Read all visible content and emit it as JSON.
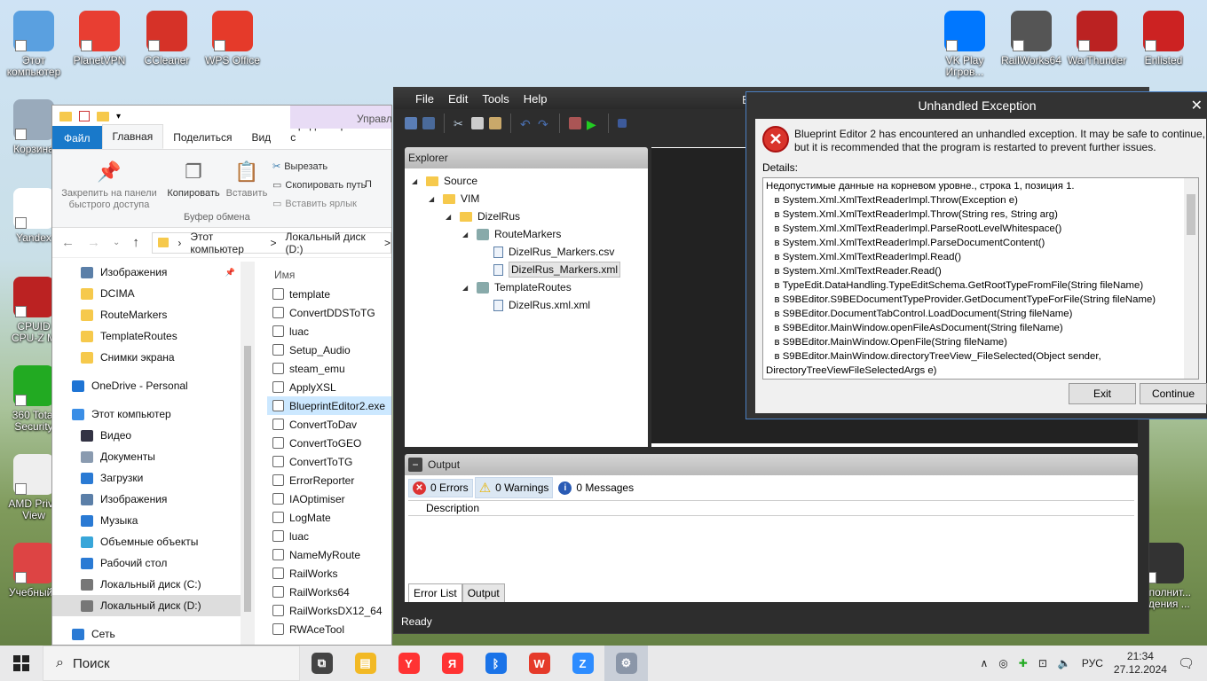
{
  "desktop_icons": [
    {
      "label": "Этот\nкомпьютер",
      "icon": "computer-icon",
      "color": "#5aa0e0"
    },
    {
      "label": "PlanetVPN",
      "icon": "planetvpn-icon",
      "color": "#e83e32"
    },
    {
      "label": "CCleaner",
      "icon": "ccleaner-icon",
      "color": "#d63228"
    },
    {
      "label": "WPS Office",
      "icon": "wps-office-icon",
      "color": "#e53a2a"
    },
    {
      "label": "Корзина",
      "icon": "recycle-bin-icon",
      "color": "#9ab"
    },
    {
      "label": "Yandex",
      "icon": "yandex-icon",
      "color": "#fff"
    },
    {
      "label": "CPUID\nCPU-Z M",
      "icon": "cpuz-icon",
      "color": "#b22"
    },
    {
      "label": "360 Total\nSecurity",
      "icon": "360-security-icon",
      "color": "#2a2"
    },
    {
      "label": "AMD Priva\nView",
      "icon": "amd-icon",
      "color": "#eee"
    },
    {
      "label": "Учебный_",
      "icon": "pdf-icon",
      "color": "#d44"
    },
    {
      "label": "VK Play\nИгров...",
      "icon": "vkplay-icon",
      "color": "#0077ff"
    },
    {
      "label": "RailWorks64",
      "icon": "railworks-icon",
      "color": "#555"
    },
    {
      "label": "WarThunder",
      "icon": "warthunder-icon",
      "color": "#b22"
    },
    {
      "label": "Enlisted",
      "icon": "enlisted-icon",
      "color": "#c22"
    },
    {
      "label": "Исполнит...\nведения ...",
      "icon": "launcher-icon",
      "color": "#333"
    }
  ],
  "explorer": {
    "context_tab": "Управл",
    "tabs": [
      "Файл",
      "Главная",
      "Поделиться",
      "Вид",
      "Средства работы с"
    ],
    "ribbon": {
      "pin": "Закрепить на панели\nбыстрого доступа",
      "copy": "Копировать",
      "paste": "Вставить",
      "cut": "Вырезать",
      "copy_path": "Скопировать путь",
      "paste_shortcut": "Вставить ярлык",
      "group": "Буфер обмена",
      "more": "П"
    },
    "address": [
      "Этот компьютер",
      ">",
      "Локальный диск (D:)",
      ">"
    ],
    "nav": [
      {
        "label": "Изображения",
        "icon": "pictures-icon",
        "indent": true
      },
      {
        "label": "DCIMA",
        "icon": "folder-icon",
        "indent": true
      },
      {
        "label": "RouteMarkers",
        "icon": "folder-icon",
        "indent": true
      },
      {
        "label": "TemplateRoutes",
        "icon": "folder-icon",
        "indent": true
      },
      {
        "label": "Снимки экрана",
        "icon": "folder-icon",
        "indent": true
      },
      {
        "label": "OneDrive - Personal",
        "icon": "onedrive-icon",
        "indent": false
      },
      {
        "label": "Этот компьютер",
        "icon": "computer-icon",
        "indent": false
      },
      {
        "label": "Видео",
        "icon": "video-icon",
        "indent": true
      },
      {
        "label": "Документы",
        "icon": "documents-icon",
        "indent": true
      },
      {
        "label": "Загрузки",
        "icon": "downloads-icon",
        "indent": true
      },
      {
        "label": "Изображения",
        "icon": "pictures-icon",
        "indent": true
      },
      {
        "label": "Музыка",
        "icon": "music-icon",
        "indent": true
      },
      {
        "label": "Объемные объекты",
        "icon": "3d-objects-icon",
        "indent": true
      },
      {
        "label": "Рабочий стол",
        "icon": "desktop-icon",
        "indent": true
      },
      {
        "label": "Локальный диск (C:)",
        "icon": "drive-icon",
        "indent": true
      },
      {
        "label": "Локальный диск (D:)",
        "icon": "drive-icon",
        "indent": true,
        "selected": true
      },
      {
        "label": "Сеть",
        "icon": "network-icon",
        "indent": false
      }
    ],
    "column_name": "Имя",
    "files": [
      "template",
      "ConvertDDSToTG",
      "luac",
      "Setup_Audio",
      "steam_emu",
      "ApplyXSL",
      "BlueprintEditor2.exe",
      "ConvertToDav",
      "ConvertToGEO",
      "ConvertToTG",
      "ErrorReporter",
      "IAOptimiser",
      "LogMate",
      "luac",
      "NameMyRoute",
      "RailWorks",
      "RailWorks64",
      "RailWorksDX12_64",
      "RWAceTool"
    ],
    "selected_file": "BlueprintEditor2.exe"
  },
  "blueprint": {
    "title_fragment": "B",
    "menu": [
      "File",
      "Edit",
      "Tools",
      "Help"
    ],
    "explorer_title": "Explorer",
    "tree": [
      {
        "label": "Source",
        "level": 0,
        "arrow": "◢",
        "icon": "folder-icon"
      },
      {
        "label": "VIM",
        "level": 1,
        "arrow": "◢",
        "icon": "folder-icon"
      },
      {
        "label": "DizelRus",
        "level": 2,
        "arrow": "◢",
        "icon": "folder-icon"
      },
      {
        "label": "RouteMarkers",
        "level": 3,
        "arrow": "◢",
        "icon": "route-markers-icon"
      },
      {
        "label": "DizelRus_Markers.csv",
        "level": 4,
        "arrow": "",
        "icon": "file-icon"
      },
      {
        "label": "DizelRus_Markers.xml",
        "level": 4,
        "arrow": "",
        "icon": "file-icon",
        "selected": true
      },
      {
        "label": "TemplateRoutes",
        "level": 3,
        "arrow": "◢",
        "icon": "template-routes-icon"
      },
      {
        "label": "DizelRus.xml.xml",
        "level": 4,
        "arrow": "",
        "icon": "file-icon"
      }
    ],
    "output_title": "Output",
    "errors": "0 Errors",
    "warnings": "0 Warnings",
    "messages": "0 Messages",
    "col_description": "Description",
    "tab_errors": "Error List",
    "tab_output": "Output",
    "status": "Ready"
  },
  "dialog": {
    "title": "Unhandled Exception",
    "message": "Blueprint Editor 2 has encountered an unhandled exception. It may be safe to continue, but it is recommended that the program is restarted to prevent further issues.",
    "details_label": "Details:",
    "trace": [
      "Недопустимые данные на корневом уровне., строка 1, позиция 1.",
      "   в System.Xml.XmlTextReaderImpl.Throw(Exception e)",
      "   в System.Xml.XmlTextReaderImpl.Throw(String res, String arg)",
      "   в System.Xml.XmlTextReaderImpl.ParseRootLevelWhitespace()",
      "   в System.Xml.XmlTextReaderImpl.ParseDocumentContent()",
      "   в System.Xml.XmlTextReaderImpl.Read()",
      "   в System.Xml.XmlTextReader.Read()",
      "   в TypeEdit.DataHandling.TypeEditSchema.GetRootTypeFromFile(String fileName)",
      "   в S9BEditor.S9BEDocumentTypeProvider.GetDocumentTypeForFile(String fileName)",
      "   в S9BEditor.DocumentTabControl.LoadDocument(String fileName)",
      "   в S9BEditor.MainWindow.openFileAsDocument(String fileName)",
      "   в S9BEditor.MainWindow.OpenFile(String fileName)",
      "   в S9BEditor.MainWindow.directoryTreeView_FileSelected(Object sender,",
      "DirectoryTreeViewFileSelectedArgs e)"
    ],
    "exit": "Exit",
    "continue": "Continue"
  },
  "taskbar": {
    "search": "Поиск",
    "apps": [
      {
        "icon": "task-view-icon",
        "color": "#444"
      },
      {
        "icon": "file-explorer-icon",
        "color": "#f2b925"
      },
      {
        "icon": "yandex-browser-icon",
        "color": "#f33"
      },
      {
        "icon": "yandex-icon",
        "color": "#f33"
      },
      {
        "icon": "bluetooth-icon",
        "color": "#1a73e8"
      },
      {
        "icon": "wps-office-icon",
        "color": "#e53a2a"
      },
      {
        "icon": "zoom-icon",
        "color": "#2d8cff"
      },
      {
        "icon": "blueprint-editor-icon",
        "color": "#8a96a8",
        "active": true
      }
    ],
    "lang": "РУС",
    "time": "21:34",
    "date": "27.12.2024"
  }
}
